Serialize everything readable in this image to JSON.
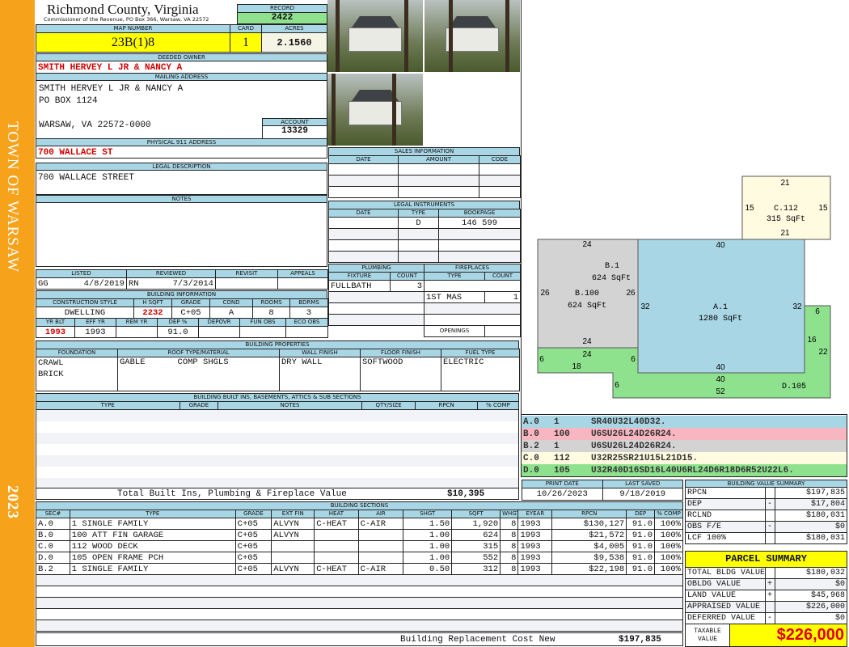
{
  "sidebar": {
    "town": "TOWN OF WARSAW",
    "year": "2023"
  },
  "header": {
    "county": "Richmond County, Virginia",
    "subtitle": "Commissioner of the Revenue, PO Box 366, Warsaw, VA 22572",
    "record_label": "RECORD",
    "record": "2422"
  },
  "parcel": {
    "map_label": "MAP NUMBER",
    "map": "23B(1)8",
    "card_label": "CARD",
    "card": "1",
    "acres_label": "ACRES",
    "acres": "2.1560"
  },
  "owner": {
    "label": "DEEDED OWNER",
    "value": "SMITH HERVEY L JR & NANCY A"
  },
  "mailing": {
    "label": "MAILING ADDRESS",
    "line1": "SMITH HERVEY L JR & NANCY A",
    "line2": "PO BOX 1124",
    "line3": "WARSAW, VA 22572-0000",
    "account_label": "ACCOUNT",
    "account": "13329"
  },
  "physical": {
    "label": "PHYSICAL 911 ADDRESS",
    "value": "700 WALLACE ST"
  },
  "legal": {
    "label": "LEGAL DESCRIPTION",
    "value": "700 WALLACE STREET"
  },
  "notes": {
    "label": "NOTES"
  },
  "listing": {
    "listed": "LISTED",
    "reviewed": "REVIEWED",
    "revisit": "REVISIT",
    "appeals": "APPEALS",
    "listed_by": "GG",
    "listed_date": "4/8/2019",
    "reviewed_by": "RN",
    "reviewed_date": "7/3/2014"
  },
  "building_info": {
    "label": "BUILDING INFORMATION",
    "h": [
      "CONSTRUCTION STYLE",
      "H SQFT",
      "GRADE",
      "COND",
      "ROOMS",
      "BDRMS"
    ],
    "v": [
      "DWELLING",
      "2232",
      "C+05",
      "A",
      "8",
      "3"
    ],
    "h2": [
      "YR BLT",
      "EFF YR",
      "REM YR",
      "DEP %",
      "DEPOVR",
      "FUN OBS",
      "ECO OBS"
    ],
    "v2": [
      "1993",
      "1993",
      "",
      "91.0",
      "",
      "",
      ""
    ]
  },
  "properties": {
    "label": "BUILDING PROPERTIES",
    "h": [
      "FOUNDATION",
      "ROOF TYPE/MATERIAL",
      "WALL FINISH",
      "FLOOR FINISH",
      "FUEL TYPE"
    ],
    "foundation1": "CRAWL",
    "foundation2": "BRICK",
    "roof_type": "GABLE",
    "roof_material": "COMP SHGLS",
    "wall": "DRY WALL",
    "floor": "SOFTWOOD",
    "fuel": "ELECTRIC"
  },
  "builtins": {
    "label": "BUILDING BUILT INS, BASEMENTS, ATTICS & SUB SECTIONS",
    "h": [
      "TYPE",
      "GRADE",
      "NOTES",
      "QTY/SIZE",
      "RPCN",
      "% COMP"
    ],
    "total_label": "Total Built Ins, Plumbing & Fireplace Value",
    "total": "$10,395"
  },
  "sales": {
    "label": "SALES INFORMATION",
    "h": [
      "DATE",
      "AMOUNT",
      "CODE"
    ]
  },
  "instruments": {
    "label": "LEGAL INSTRUMENTS",
    "h": [
      "DATE",
      "TYPE",
      "BOOKPAGE"
    ],
    "type": "D",
    "bookpage": "146 599"
  },
  "plumbing": {
    "label": "PLUMBING",
    "h": [
      "FIXTURE",
      "COUNT"
    ],
    "fixture": "FULLBATH",
    "count": "3"
  },
  "fireplaces": {
    "label": "FIREPLACES",
    "h": [
      "TYPE",
      "COUNT"
    ],
    "type": "1ST MAS",
    "count": "1",
    "openings": "OPENINGS"
  },
  "sketch": {
    "labels": {
      "c_top": "21",
      "c_left": "15",
      "c_right": "15",
      "c_name": "C.112",
      "c_area": "315 SqFt",
      "c_bot": "21",
      "b_top": "24",
      "b1_name": "B.1",
      "b1_area": "624 SqFt",
      "b_left": "26",
      "b100_name": "B.100",
      "b_right": "26",
      "b100_area": "624 SqFt",
      "b_bot": "24",
      "a_top": "40",
      "a_left": "32",
      "a_right": "32",
      "a_name": "A.1",
      "a_area": "1280 SqFt",
      "a_bot": "40",
      "d_24": "24",
      "d_6a": "6",
      "d_18": "18",
      "d_6b": "6",
      "d_6c": "6",
      "d_40": "40",
      "d_52": "52",
      "d_6d": "6",
      "d_16": "16",
      "d_22": "22",
      "d_name": "D.105"
    }
  },
  "sketch_codes": [
    {
      "sec": "A.0",
      "code": "1",
      "path": "SR40U32L40D32.",
      "color": "#a9d6e5"
    },
    {
      "sec": "B.0",
      "code": "100",
      "path": "U6SU26L24D26R24.",
      "color": "#f8b6c1"
    },
    {
      "sec": "B.2",
      "code": "1",
      "path": "U6SU26L24D26R24.",
      "color": "#d3d3d3"
    },
    {
      "sec": "C.0",
      "code": "112",
      "path": "U32R25SR21U15L21D15.",
      "color": "#fffbe0"
    },
    {
      "sec": "D.0",
      "code": "105",
      "path": "U32R40D16SD16L40U6RL24D6R18D6R52U22L6.",
      "color": "#8ee28e"
    }
  ],
  "dates": {
    "print_label": "PRINT DATE",
    "print": "10/26/2023",
    "saved_label": "LAST SAVED",
    "saved": "9/18/2019"
  },
  "sections": {
    "label": "BUILDING SECTIONS",
    "h": [
      "SEC#",
      "TYPE",
      "GRADE",
      "EXT FIN",
      "HEAT",
      "AIR",
      "SHGT",
      "SQFT",
      "WHGT",
      "EYEAR",
      "RPCN",
      "DEP",
      "% COMP"
    ],
    "rows": [
      [
        "A.0",
        "1 SINGLE FAMILY",
        "C+05",
        "ALVYN",
        "C-HEAT",
        "C-AIR",
        "1.50",
        "1,920",
        "8",
        "1993",
        "$130,127",
        "91.0",
        "100%"
      ],
      [
        "B.0",
        "100 ATT FIN GARAGE",
        "C+05",
        "ALVYN",
        "",
        "",
        "1.00",
        "624",
        "8",
        "1993",
        "$21,572",
        "91.0",
        "100%"
      ],
      [
        "C.0",
        "112 WOOD DECK",
        "C+05",
        "",
        "",
        "",
        "1.00",
        "315",
        "8",
        "1993",
        "$4,005",
        "91.0",
        "100%"
      ],
      [
        "D.0",
        "105 OPEN FRAME PCH",
        "C+05",
        "",
        "",
        "",
        "1.00",
        "552",
        "8",
        "1993",
        "$9,538",
        "91.0",
        "100%"
      ],
      [
        "B.2",
        "1 SINGLE FAMILY",
        "C+05",
        "ALVYN",
        "C-HEAT",
        "C-AIR",
        "0.50",
        "312",
        "8",
        "1993",
        "$22,198",
        "91.0",
        "100%"
      ]
    ],
    "replacement_label": "Building Replacement Cost New",
    "replacement": "$197,835"
  },
  "value_summary": {
    "label": "BUILDING VALUE SUMMARY",
    "rows": [
      [
        "RPCN",
        "",
        "$197,835"
      ],
      [
        "DEP",
        "-",
        "$17,804"
      ],
      [
        "RCLND",
        "",
        "$180,031"
      ],
      [
        "OBS F/E",
        "-",
        "$0"
      ],
      [
        "LCF  100%",
        "",
        "$180,031"
      ]
    ]
  },
  "parcel_summary": {
    "label": "PARCEL SUMMARY",
    "rows": [
      [
        "TOTAL BLDG VALUE",
        "",
        "$180,032"
      ],
      [
        "OBLDG VALUE",
        "+",
        "$0"
      ],
      [
        "LAND VALUE",
        "+",
        "$45,968"
      ],
      [
        "APPRAISED VALUE",
        "",
        "$226,000"
      ],
      [
        "DEFERRED VALUE",
        "-",
        "$0"
      ]
    ],
    "taxable_label1": "TAXABLE",
    "taxable_label2": "VALUE",
    "taxable": "$226,000"
  }
}
